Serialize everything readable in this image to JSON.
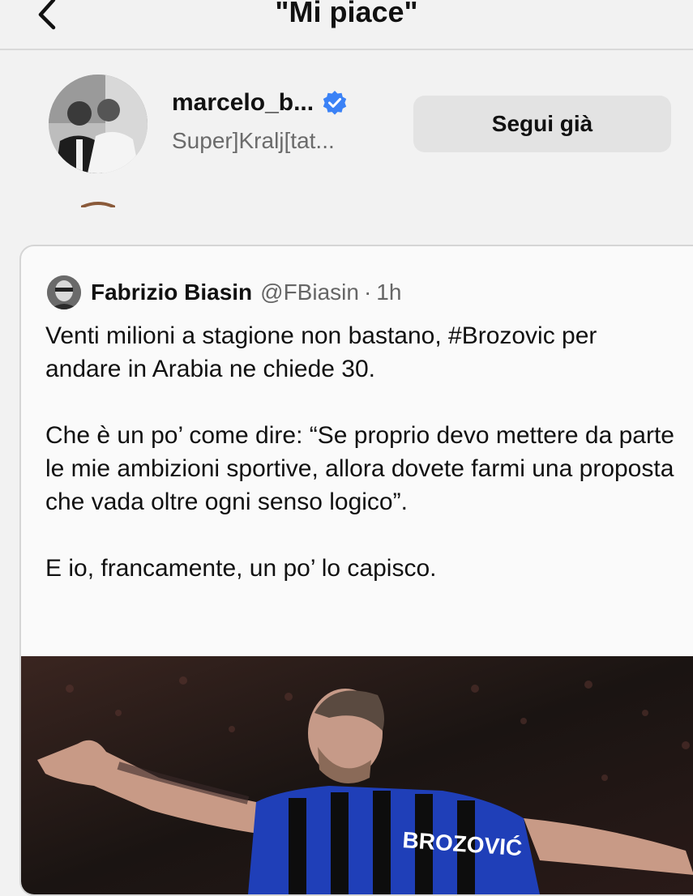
{
  "header": {
    "title": "\"Mi piace\""
  },
  "account": {
    "username": "marcelo_b...",
    "fullname": "Super]Kralj[tat...",
    "follow_label": "Segui già"
  },
  "tweet": {
    "author_name": "Fabrizio Biasin",
    "author_handle": "@FBiasin",
    "separator": "·",
    "time": "1h",
    "paragraphs": [
      "Venti milioni a stagione non bastano, #Brozovic per andare in Arabia ne chiede 30.",
      "Che è un po’ come dire: “Se proprio devo mettere da parte le mie ambizioni sportive, allora dovete farmi una proposta che vada oltre ogni senso logico”.",
      "E io, francamente, un po’ lo capisco."
    ],
    "image_jersey_text": "BROZOVIĆ"
  },
  "colors": {
    "background": "#f2f2f2",
    "follow_button": "#e3e3e3",
    "verified": "#3b82f6",
    "jersey_blue": "#1f3fb8"
  }
}
